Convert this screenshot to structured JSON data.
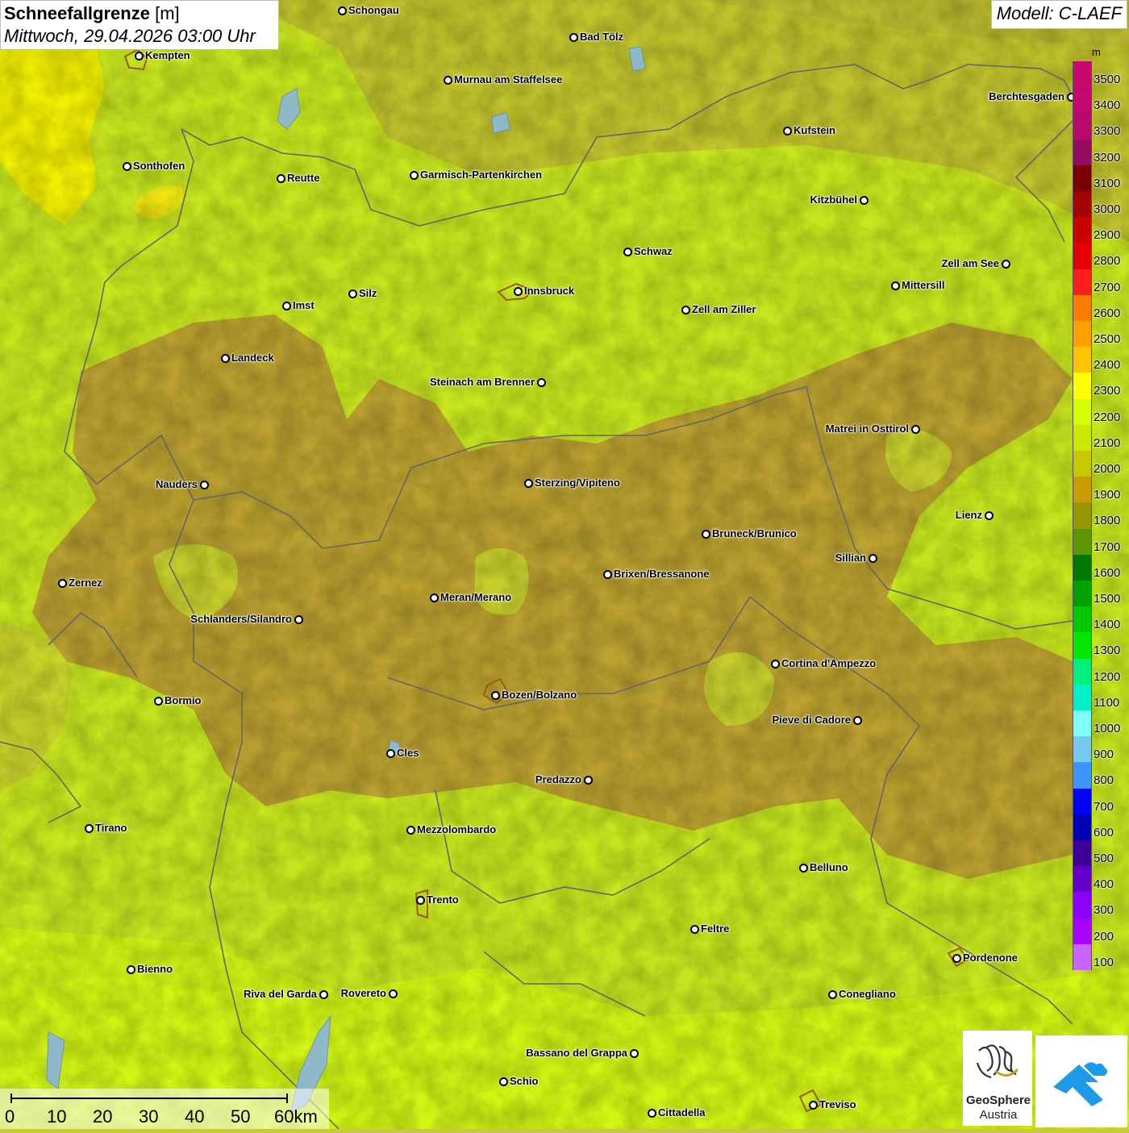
{
  "header": {
    "title_bold": "Schneefallgrenze",
    "title_unit": "[m]",
    "datetime": "Mittwoch, 29.04.2026 03:00 Uhr"
  },
  "model_label": "Modell: C-LAEF",
  "legend": {
    "unit": "m",
    "levels": [
      {
        "label": "3500",
        "color": "#c7086f"
      },
      {
        "label": "3400",
        "color": "#c20870"
      },
      {
        "label": "3300",
        "color": "#b80a6c"
      },
      {
        "label": "3200",
        "color": "#960a60"
      },
      {
        "label": "3100",
        "color": "#7a0000"
      },
      {
        "label": "3000",
        "color": "#a40000"
      },
      {
        "label": "2900",
        "color": "#c80000"
      },
      {
        "label": "2800",
        "color": "#e40000"
      },
      {
        "label": "2700",
        "color": "#ff1e1e"
      },
      {
        "label": "2600",
        "color": "#ff7c00"
      },
      {
        "label": "2500",
        "color": "#ffa000"
      },
      {
        "label": "2400",
        "color": "#ffc400"
      },
      {
        "label": "2300",
        "color": "#ffff00"
      },
      {
        "label": "2200",
        "color": "#d4ff00"
      },
      {
        "label": "2100",
        "color": "#c8e800"
      },
      {
        "label": "2000",
        "color": "#c8c800"
      },
      {
        "label": "1900",
        "color": "#c89c00"
      },
      {
        "label": "1800",
        "color": "#969600"
      },
      {
        "label": "1700",
        "color": "#5a9600"
      },
      {
        "label": "1600",
        "color": "#007800"
      },
      {
        "label": "1500",
        "color": "#00a000"
      },
      {
        "label": "1400",
        "color": "#00c800"
      },
      {
        "label": "1300",
        "color": "#00e600"
      },
      {
        "label": "1200",
        "color": "#00f080"
      },
      {
        "label": "1100",
        "color": "#00f0c8"
      },
      {
        "label": "1000",
        "color": "#80ffff"
      },
      {
        "label": "900",
        "color": "#78c8f0"
      },
      {
        "label": "800",
        "color": "#3c96ff"
      },
      {
        "label": "700",
        "color": "#0000ff"
      },
      {
        "label": "600",
        "color": "#0000b4"
      },
      {
        "label": "500",
        "color": "#3c0096"
      },
      {
        "label": "400",
        "color": "#6400c8"
      },
      {
        "label": "300",
        "color": "#8c00ff"
      },
      {
        "label": "200",
        "color": "#aa00ff"
      },
      {
        "label": "100",
        "color": "#c864ff"
      }
    ]
  },
  "scale": {
    "labels": [
      "0",
      "10",
      "20",
      "30",
      "40",
      "50",
      "60km"
    ]
  },
  "logos": {
    "geosphere_line1": "GeoSphere",
    "geosphere_line2": "Austria"
  },
  "cities": [
    {
      "name": "Schongau",
      "anchor": "right"
    },
    {
      "name": "Bad Tölz",
      "anchor": "right"
    },
    {
      "name": "Kempten",
      "anchor": "right"
    },
    {
      "name": "Murnau am Staffelsee",
      "anchor": "right"
    },
    {
      "name": "Berchtesgaden",
      "anchor": "left"
    },
    {
      "name": "Kufstein",
      "anchor": "right"
    },
    {
      "name": "Sonthofen",
      "anchor": "right"
    },
    {
      "name": "Reutte",
      "anchor": "right"
    },
    {
      "name": "Garmisch-Partenkirchen",
      "anchor": "right"
    },
    {
      "name": "Kitzbühel",
      "anchor": "left"
    },
    {
      "name": "Schwaz",
      "anchor": "right"
    },
    {
      "name": "Zell am See",
      "anchor": "left"
    },
    {
      "name": "Mittersill",
      "anchor": "right"
    },
    {
      "name": "Innsbruck",
      "anchor": "right"
    },
    {
      "name": "Silz",
      "anchor": "right"
    },
    {
      "name": "Imst",
      "anchor": "right"
    },
    {
      "name": "Zell am Ziller",
      "anchor": "right"
    },
    {
      "name": "Landeck",
      "anchor": "right"
    },
    {
      "name": "Steinach am Brenner",
      "anchor": "left"
    },
    {
      "name": "Matrei in Osttirol",
      "anchor": "left"
    },
    {
      "name": "Nauders",
      "anchor": "left"
    },
    {
      "name": "Sterzing/Vipiteno",
      "anchor": "right"
    },
    {
      "name": "Lienz",
      "anchor": "left"
    },
    {
      "name": "Bruneck/Brunico",
      "anchor": "right"
    },
    {
      "name": "Sillian",
      "anchor": "left"
    },
    {
      "name": "Brixen/Bressanone",
      "anchor": "right"
    },
    {
      "name": "Zernez",
      "anchor": "right"
    },
    {
      "name": "Meran/Merano",
      "anchor": "right"
    },
    {
      "name": "Schlanders/Silandro",
      "anchor": "left"
    },
    {
      "name": "Cortina d'Ampezzo",
      "anchor": "right"
    },
    {
      "name": "Bormio",
      "anchor": "right"
    },
    {
      "name": "Bozen/Bolzano",
      "anchor": "right"
    },
    {
      "name": "Pieve di Cadore",
      "anchor": "left"
    },
    {
      "name": "Cles",
      "anchor": "right"
    },
    {
      "name": "Predazzo",
      "anchor": "left"
    },
    {
      "name": "Tirano",
      "anchor": "right"
    },
    {
      "name": "Mezzolombardo",
      "anchor": "right"
    },
    {
      "name": "Belluno",
      "anchor": "right"
    },
    {
      "name": "Trento",
      "anchor": "right"
    },
    {
      "name": "Feltre",
      "anchor": "right"
    },
    {
      "name": "Pordenone",
      "anchor": "right"
    },
    {
      "name": "Bienno",
      "anchor": "right"
    },
    {
      "name": "Riva del Garda",
      "anchor": "left"
    },
    {
      "name": "Rovereto",
      "anchor": "left"
    },
    {
      "name": "Conegliano",
      "anchor": "right"
    },
    {
      "name": "Bassano del Grappa",
      "anchor": "left"
    },
    {
      "name": "Schio",
      "anchor": "right"
    },
    {
      "name": "Treviso",
      "anchor": "right"
    },
    {
      "name": "Cittadella",
      "anchor": "right"
    }
  ]
}
